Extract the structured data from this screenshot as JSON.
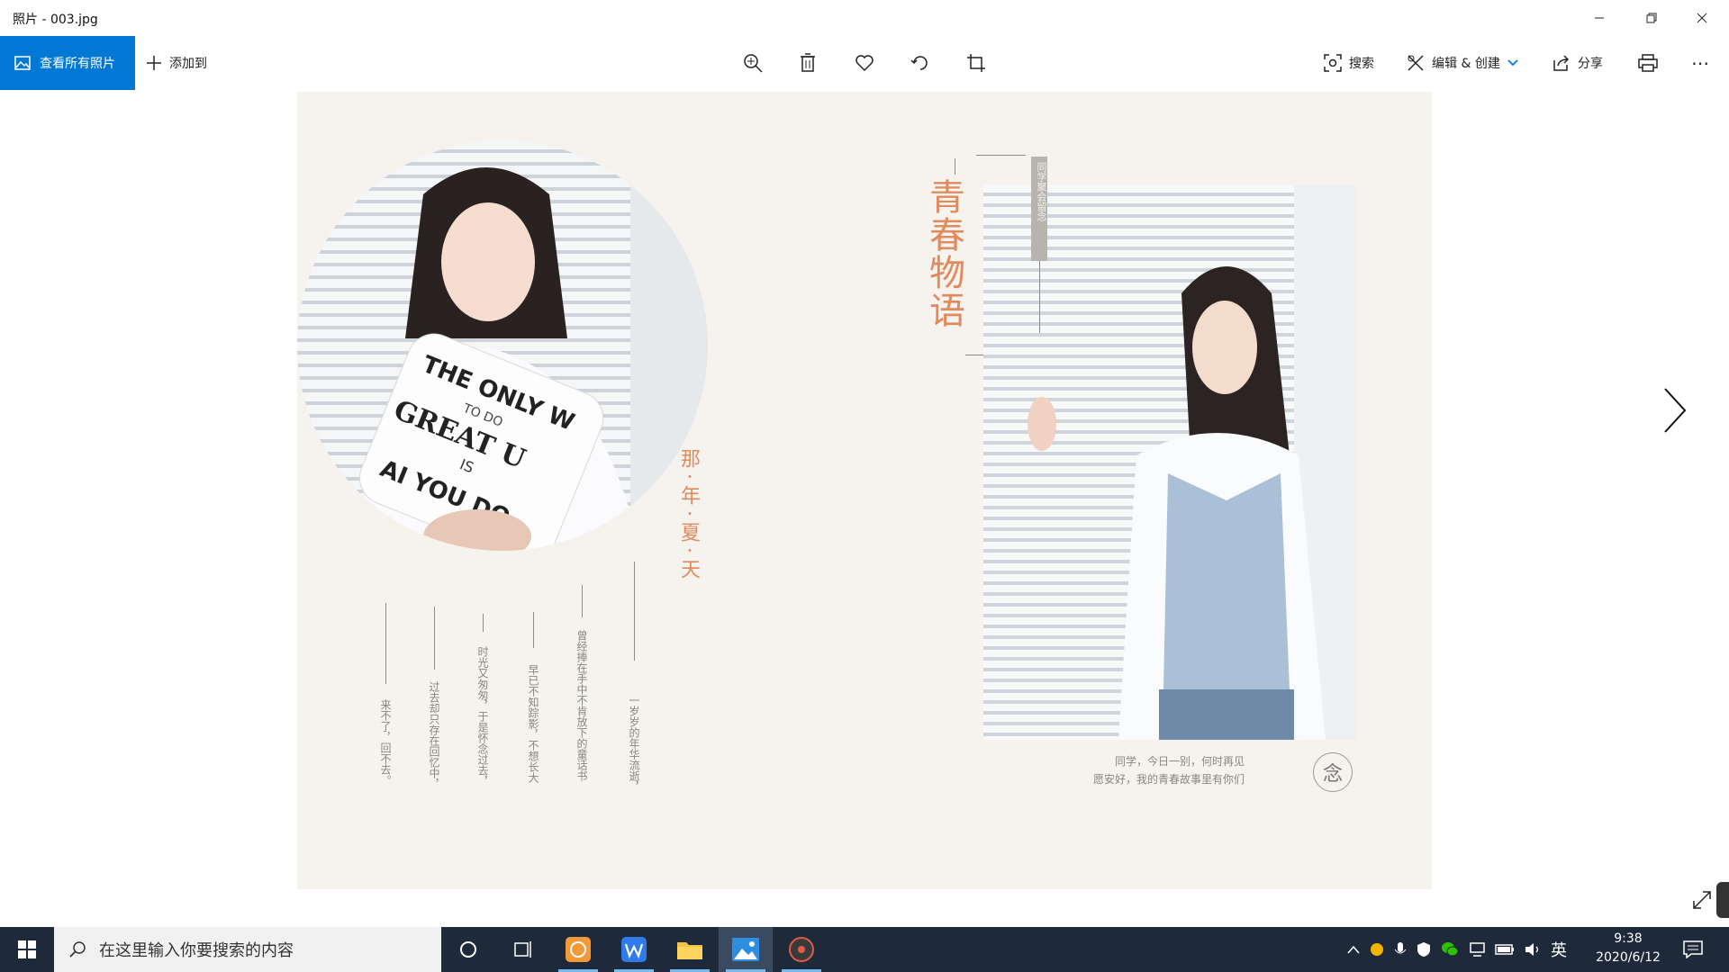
{
  "window": {
    "title": "照片 - 003.jpg"
  },
  "toolbar": {
    "view_all_label": "查看所有照片",
    "add_to_label": "添加到",
    "search_label": "搜索",
    "edit_create_label": "编辑 & 创建",
    "share_label": "分享",
    "more_label": "⋯"
  },
  "photo": {
    "title_chars": "青春物语",
    "badge_text": "同学聚会留念",
    "summer_text": "那·年·夏·天",
    "poem_lines": [
      "来不了，回不去。",
      "过去却只存在回忆中，",
      "时光又匆匆，于是怀念过去，",
      "早已不知踪影，不想长大",
      "曾经捧在手中不肯放下的童话书",
      "一岁岁的年华流逝，"
    ],
    "caption_line1": "同学，今日一别，何时再见",
    "caption_line2": "愿安好，我的青春故事里有你们",
    "seal_char": "念",
    "pillow_line1": "THE ONLY W",
    "pillow_line2": "TO DO",
    "pillow_line3": "GREAT U",
    "pillow_line4": "IS",
    "pillow_line5": "AI YOU DO"
  },
  "taskbar": {
    "search_placeholder": "在这里输入你要搜索的内容",
    "ime_label": "英",
    "time": "9:38",
    "date": "2020/6/12"
  },
  "colors": {
    "accent": "#0078d4",
    "taskbar": "#1e2a3a",
    "title_orange": "#e08a5e"
  }
}
